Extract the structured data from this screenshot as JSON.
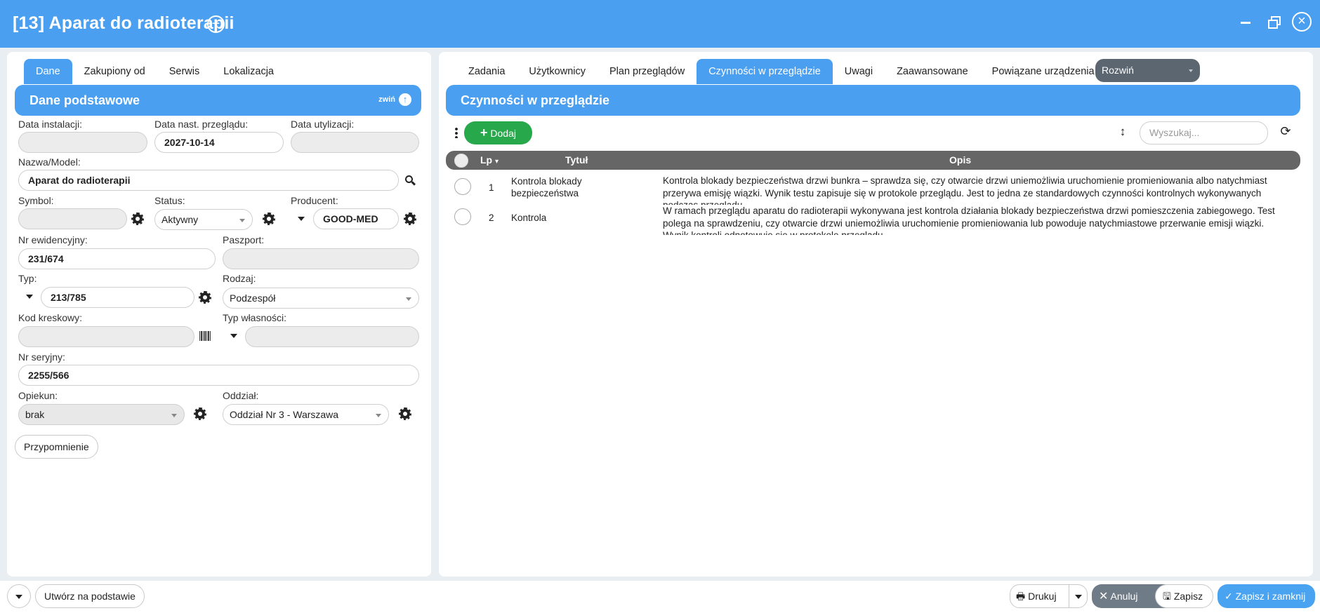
{
  "window": {
    "title": "[13] Aparat do radioterapii",
    "add_icon": "plus-circle-icon",
    "controls": [
      "minimize-icon",
      "restore-icon",
      "close-icon"
    ]
  },
  "left": {
    "tabs": [
      {
        "label": "Dane",
        "active": true
      },
      {
        "label": "Zakupiony od",
        "active": false
      },
      {
        "label": "Serwis",
        "active": false
      },
      {
        "label": "Lokalizacja",
        "active": false
      }
    ],
    "section_title": "Dane podstawowe",
    "collapse_label": "zwiń",
    "fields": {
      "data_instalacji": {
        "label": "Data instalacji:",
        "value": ""
      },
      "data_nast_przegladu": {
        "label": "Data nast. przeglądu:",
        "value": "2027-10-14"
      },
      "data_utylizacji": {
        "label": "Data utylizacji:",
        "value": ""
      },
      "nazwa_model": {
        "label": "Nazwa/Model:",
        "value": "Aparat do radioterapii"
      },
      "symbol": {
        "label": "Symbol:",
        "value": ""
      },
      "status": {
        "label": "Status:",
        "value": "Aktywny"
      },
      "producent": {
        "label": "Producent:",
        "value": "GOOD-MED"
      },
      "nr_ewidencyjny": {
        "label": "Nr ewidencyjny:",
        "value": "231/674"
      },
      "paszport": {
        "label": "Paszport:",
        "value": ""
      },
      "typ": {
        "label": "Typ:",
        "value": "213/785"
      },
      "rodzaj": {
        "label": "Rodzaj:",
        "value": "Podzespół"
      },
      "kod_kreskowy": {
        "label": "Kod kreskowy:",
        "value": ""
      },
      "typ_wlasnosci": {
        "label": "Typ własności:",
        "value": ""
      },
      "nr_seryjny": {
        "label": "Nr seryjny:",
        "value": "2255/566"
      },
      "opiekun": {
        "label": "Opiekun:",
        "value": "brak"
      },
      "oddzial": {
        "label": "Oddział:",
        "value": "Oddział Nr 3 - Warszawa"
      }
    },
    "reminder_button": "Przypomnienie"
  },
  "right": {
    "tabs": [
      {
        "label": "Zadania",
        "active": false
      },
      {
        "label": "Użytkownicy",
        "active": false
      },
      {
        "label": "Plan przeglądów",
        "active": false
      },
      {
        "label": "Czynności w przeglądzie",
        "active": true
      },
      {
        "label": "Uwagi",
        "active": false
      },
      {
        "label": "Zaawansowane",
        "active": false
      },
      {
        "label": "Powiązane urządzenia",
        "active": false
      }
    ],
    "expand_label": "Rozwiń",
    "section_title": "Czynności w przeglądzie",
    "add_button": "Dodaj",
    "search_placeholder": "Wyszukaj...",
    "table": {
      "columns": {
        "lp": "Lp",
        "title": "Tytuł",
        "desc": "Opis"
      },
      "rows": [
        {
          "lp": "1",
          "title": "Kontrola blokady bezpieczeństwa",
          "desc": "Kontrola blokady bezpieczeństwa drzwi bunkra – sprawdza się, czy otwarcie drzwi uniemożliwia uruchomienie promieniowania albo natychmiast przerywa emisję wiązki. Wynik testu zapisuje się w protokole przeglądu. Jest to jedna ze standardowych czynności kontrolnych wykonywanych podczas przeglądu."
        },
        {
          "lp": "2",
          "title": "Kontrola",
          "desc": "W ramach przeglądu aparatu do radioterapii wykonywana jest kontrola działania blokady bezpieczeństwa drzwi pomieszczenia zabiegowego. Test polega na sprawdzeniu, czy otwarcie drzwi uniemożliwia uruchomienie promieniowania lub powoduje natychmiastowe przerwanie emisji wiązki. Wynik kontroli odnotowuje się w protokole przeglądu."
        }
      ]
    }
  },
  "bottom": {
    "create_based": "Utwórz na podstawie",
    "print": "Drukuj",
    "cancel": "Anuluj",
    "save": "Zapisz",
    "save_close": "Zapisz i zamknij"
  }
}
